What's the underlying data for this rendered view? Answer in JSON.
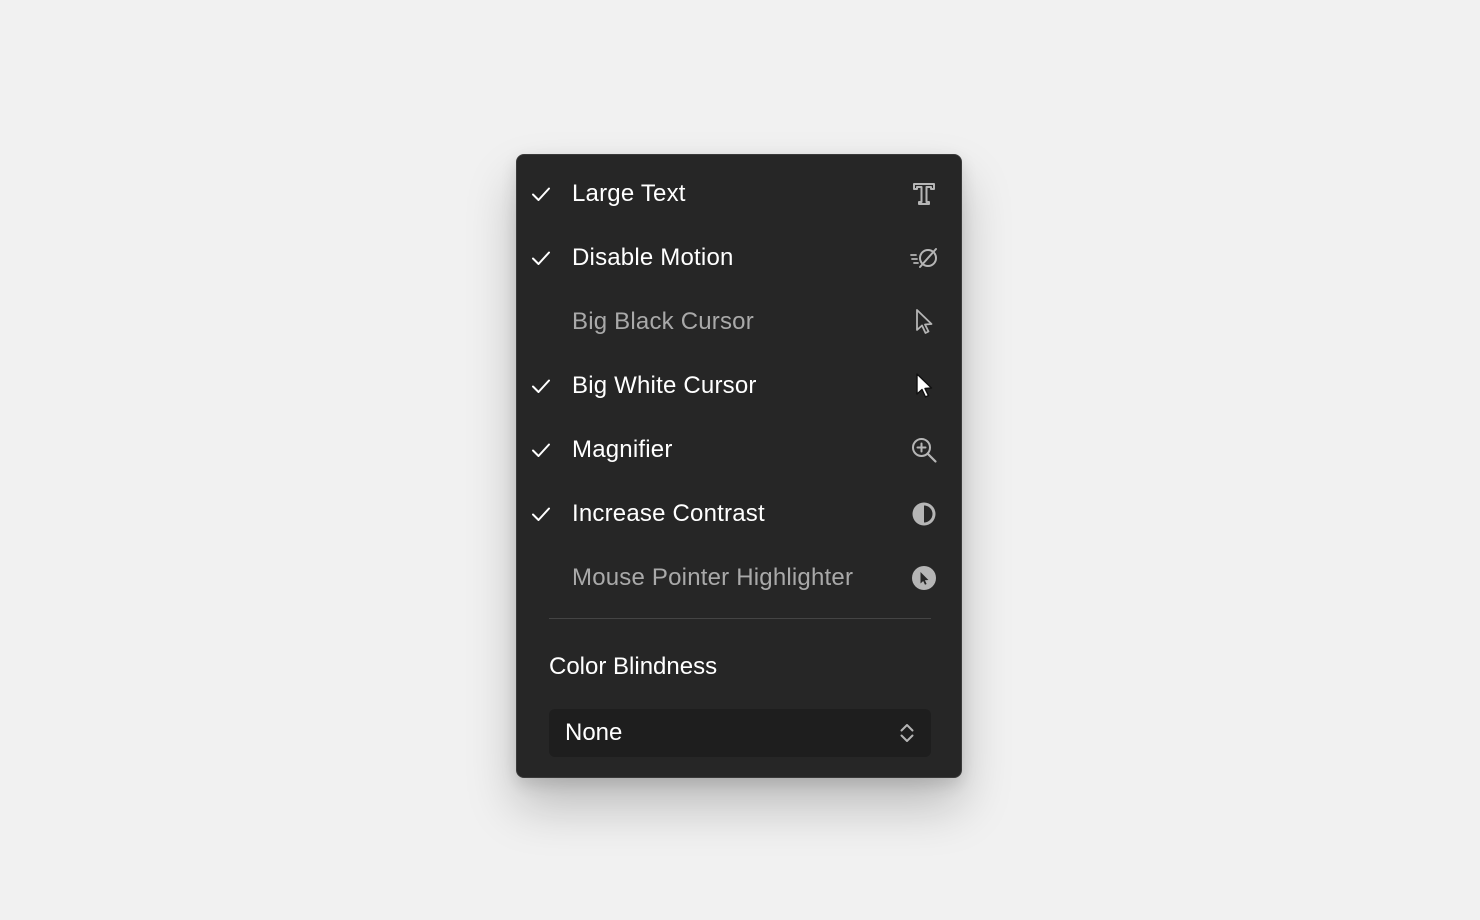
{
  "menu": {
    "items": [
      {
        "label": "Large Text",
        "checked": true,
        "icon": "large-text-icon"
      },
      {
        "label": "Disable Motion",
        "checked": true,
        "icon": "disable-motion-icon"
      },
      {
        "label": "Big Black Cursor",
        "checked": false,
        "icon": "cursor-outline-icon"
      },
      {
        "label": "Big White Cursor",
        "checked": true,
        "icon": "cursor-filled-icon"
      },
      {
        "label": "Magnifier",
        "checked": true,
        "icon": "zoom-in-icon"
      },
      {
        "label": "Increase Contrast",
        "checked": true,
        "icon": "contrast-icon"
      },
      {
        "label": "Mouse Pointer Highlighter",
        "checked": false,
        "icon": "pointer-highlight-icon"
      }
    ]
  },
  "color_blindness": {
    "label": "Color Blindness",
    "selected": "None"
  },
  "colors": {
    "panel_bg": "#262626",
    "text_on": "#ffffff",
    "text_off": "#a9a9a9",
    "icon": "#b5b5b5",
    "select_bg": "#1e1e1e"
  }
}
